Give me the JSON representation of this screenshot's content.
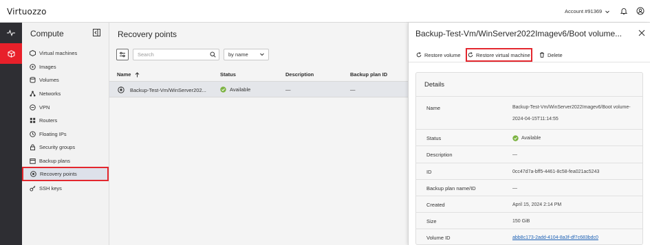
{
  "topbar": {
    "logo": "Virtuozzo",
    "account_label": "Account #91369",
    "icons": [
      "chevron-down-icon",
      "bell-icon",
      "user-icon"
    ]
  },
  "rail": {
    "items": [
      {
        "icon": "activity-icon",
        "active": false
      },
      {
        "icon": "cube-icon",
        "active": true
      }
    ],
    "accent": "#e8202a"
  },
  "sidenav": {
    "title": "Compute",
    "items": [
      {
        "label": "Virtual machines",
        "icon": "vm-icon",
        "active": false
      },
      {
        "label": "Images",
        "icon": "image-icon",
        "active": false
      },
      {
        "label": "Volumes",
        "icon": "volume-icon",
        "active": false
      },
      {
        "label": "Networks",
        "icon": "network-icon",
        "active": false
      },
      {
        "label": "VPN",
        "icon": "vpn-icon",
        "active": false
      },
      {
        "label": "Routers",
        "icon": "router-icon",
        "active": false
      },
      {
        "label": "Floating IPs",
        "icon": "floating-ip-icon",
        "active": false
      },
      {
        "label": "Security groups",
        "icon": "lock-icon",
        "active": false
      },
      {
        "label": "Backup plans",
        "icon": "calendar-icon",
        "active": false
      },
      {
        "label": "Recovery points",
        "icon": "recovery-icon",
        "active": true
      },
      {
        "label": "SSH keys",
        "icon": "key-icon",
        "active": false
      }
    ]
  },
  "main": {
    "title": "Recovery points",
    "search_placeholder": "Search",
    "sort_value": "by name",
    "columns": [
      "Name",
      "Status",
      "Description",
      "Backup plan ID"
    ],
    "rows": [
      {
        "name": "Backup-Test-Vm/WinServer202...",
        "status": "Available",
        "description": "—",
        "backup_plan_id": "—"
      }
    ]
  },
  "panel": {
    "title": "Backup-Test-Vm/WinServer2022Imagev6/Boot volume...",
    "actions": {
      "restore_volume": "Restore volume",
      "restore_vm": "Restore virtual machine",
      "delete": "Delete"
    },
    "details_title": "Details",
    "details": [
      {
        "label": "Name",
        "value": "Backup-Test-Vm/WinServer2022Imagev6/Boot volume-2024-04-15T11:14:55"
      },
      {
        "label": "Status",
        "value": "Available"
      },
      {
        "label": "Description",
        "value": "—"
      },
      {
        "label": "ID",
        "value": "0cc47d7a-bff5-4461-8c58-fea021ac5243"
      },
      {
        "label": "Backup plan name/ID",
        "value": "—"
      },
      {
        "label": "Created",
        "value": "April 15, 2024 2:14 PM"
      },
      {
        "label": "Size",
        "value": "150 GiB"
      },
      {
        "label": "Volume ID",
        "value": "abb8c173-2add-4104-8a3f-df7c683bdc0"
      }
    ]
  },
  "colors": {
    "highlight": "#e3262d",
    "available": "#7cb342",
    "link": "#1a5fb4"
  }
}
